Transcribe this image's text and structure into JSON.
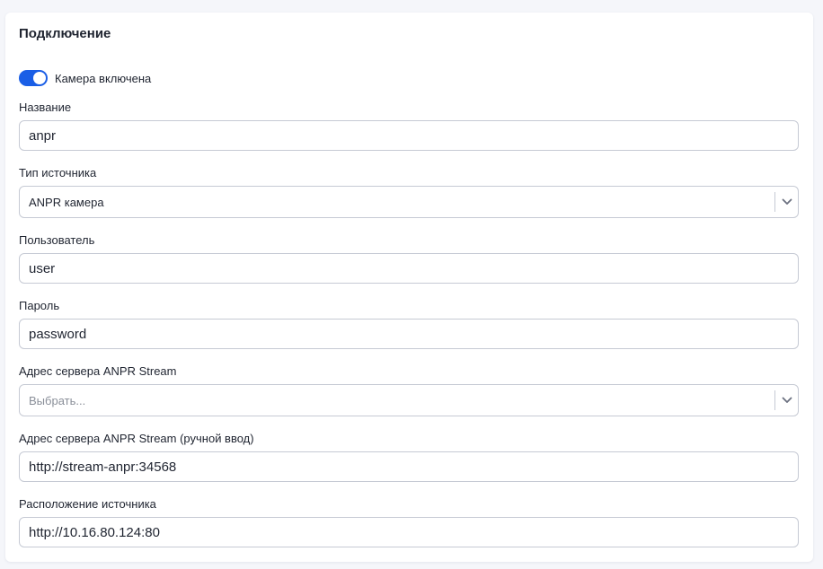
{
  "section": {
    "title": "Подключение"
  },
  "camera_toggle": {
    "label": "Камера включена",
    "enabled": true,
    "accent_color": "#1a5ee6"
  },
  "fields": {
    "name": {
      "label": "Название",
      "value": "anpr"
    },
    "source_type": {
      "label": "Тип источника",
      "selected": "ANPR камера",
      "icon": "chevron-down-icon"
    },
    "user": {
      "label": "Пользователь",
      "value": "user"
    },
    "password": {
      "label": "Пароль",
      "value": "password"
    },
    "stream_server": {
      "label": "Адрес сервера ANPR Stream",
      "placeholder": "Выбрать...",
      "icon": "chevron-down-icon"
    },
    "stream_server_manual": {
      "label": "Адрес сервера ANPR Stream (ручной ввод)",
      "value": "http://stream-anpr:34568"
    },
    "source_location": {
      "label": "Расположение источника",
      "value": "http://10.16.80.124:80"
    }
  }
}
